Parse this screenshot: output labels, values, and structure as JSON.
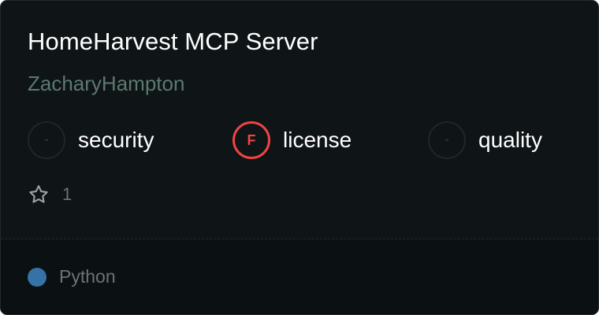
{
  "card": {
    "title": "HomeHarvest MCP Server",
    "author": "ZacharyHampton",
    "scores": [
      {
        "key": "security",
        "grade": "-",
        "label": "security"
      },
      {
        "key": "license",
        "grade": "F",
        "label": "license",
        "grade_color": "#ef4444"
      },
      {
        "key": "quality",
        "grade": "-",
        "label": "quality"
      }
    ],
    "stars": {
      "icon": "star-outline-icon",
      "count": "1"
    },
    "language": {
      "name": "Python",
      "color": "#3572a5"
    }
  }
}
